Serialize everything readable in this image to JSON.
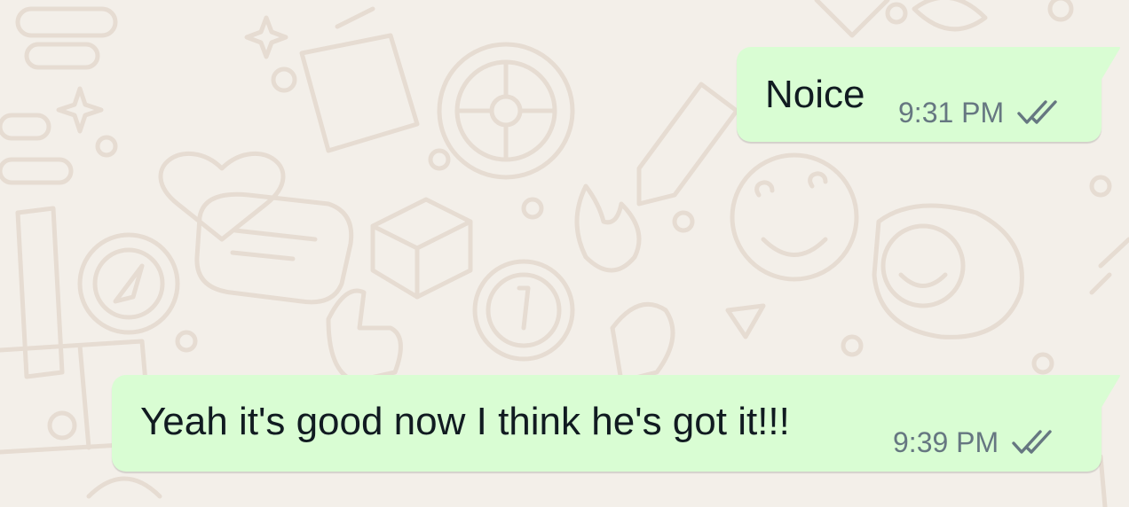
{
  "chat": {
    "background_color": "#f3efe9",
    "bubble_color": "#d9fdd3",
    "messages": [
      {
        "text": "Noice",
        "time": "9:31 PM",
        "status_icon": "double-check-icon",
        "direction": "outgoing"
      },
      {
        "text": "Yeah it's good now I think he's got it!!!",
        "time": "9:39 PM",
        "status_icon": "double-check-icon",
        "direction": "outgoing"
      }
    ]
  }
}
